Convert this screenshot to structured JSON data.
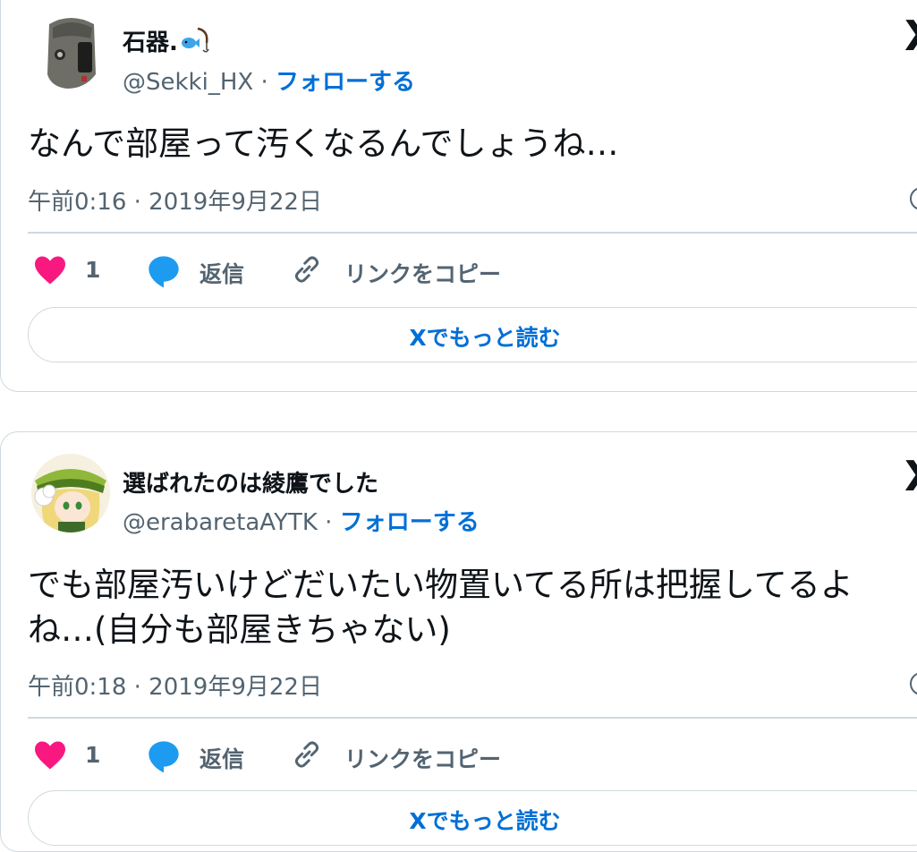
{
  "tweets": [
    {
      "author_name": "石器.",
      "handle": "@Sekki_HX",
      "separator": "·",
      "follow_label": "フォローする",
      "body_lines": [
        "なんで部屋って汚くなるんでしょうね…"
      ],
      "timestamp": "午前0:16 · 2019年9月22日",
      "likes": "1",
      "reply_label": "返信",
      "copy_link_label": "リンクをコピー",
      "read_more_label": "Xでもっと読む",
      "avatar_icon": "gray-mask-avatar",
      "badge_icon": "fishing-emoji-icon"
    },
    {
      "author_name": "選ばれたのは綾鷹でした",
      "handle": "@erabaretaAYTK",
      "separator": "·",
      "follow_label": "フォローする",
      "body_lines": [
        "でも部屋汚いけどだいたい物置いてる所は把握してるよ",
        "ね…(自分も部屋きちゃない)"
      ],
      "timestamp": "午前0:18 · 2019年9月22日",
      "likes": "1",
      "reply_label": "返信",
      "copy_link_label": "リンクをコピー",
      "read_more_label": "Xでもっと読む",
      "avatar_icon": "anime-girl-avatar"
    }
  ],
  "colors": {
    "heart": "#f91880",
    "reply_bubble": "#1d9bf0",
    "link_blue": "#006fd6",
    "border": "#cfd9de",
    "muted_text": "#536471"
  }
}
